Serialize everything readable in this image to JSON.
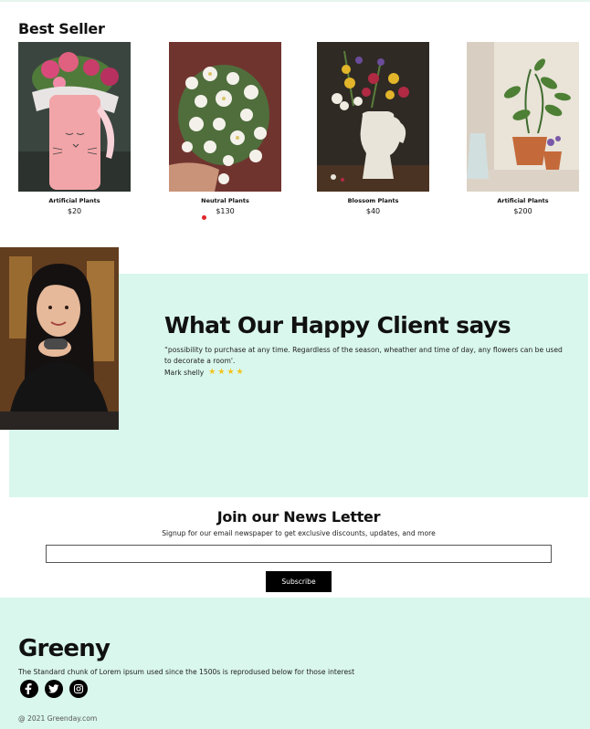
{
  "best_seller": {
    "title": "Best Seller",
    "products": [
      {
        "name": "Artificial Plants",
        "price": "$20"
      },
      {
        "name": "Neutral Plants",
        "price": "$130"
      },
      {
        "name": "Blossom Plants",
        "price": "$40"
      },
      {
        "name": "Artificial Plants",
        "price": "$200"
      }
    ],
    "active_dot_color": "#e0262b"
  },
  "testimonial": {
    "title": "What Our Happy Client says",
    "quote": "“possibility to purchase at any time. Regardless of the season, wheather and time of day, any flowers can be used to decorate a room'.",
    "author": "Mark shelly",
    "rating": 4,
    "star_color": "#f4c21b",
    "background_color": "#d9f7ec"
  },
  "newsletter": {
    "title": "Join our News Letter",
    "subtitle": "Signup for our email newspaper to get exclusive discounts, updates, and more",
    "email_value": "",
    "subscribe_label": "Subscribe"
  },
  "footer": {
    "brand": "Greeny",
    "description": "The Standard chunk of Lorem ipsum used since the 1500s is reprodused below for those interest",
    "socials": [
      "facebook-icon",
      "twitter-icon",
      "instagram-icon"
    ],
    "copyright": "@ 2021 Greenday.com",
    "background_color": "#d9f7ec"
  }
}
